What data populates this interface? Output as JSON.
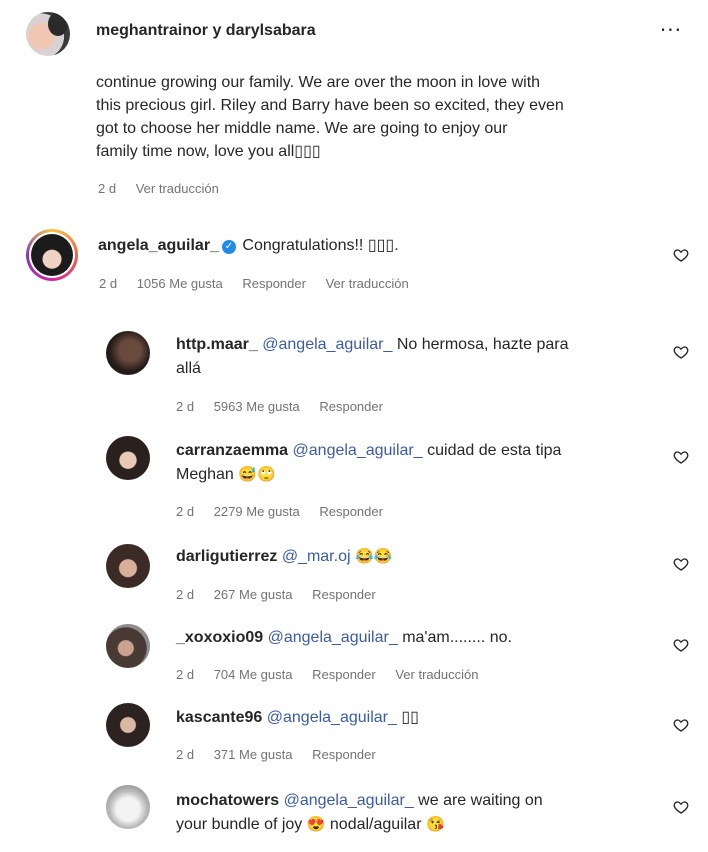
{
  "post": {
    "owner_names": "meghantrainor y darylsabara",
    "more_icon": "more-horizontal-icon",
    "caption_lines": [
      "continue growing our family. We are over the moon in love with",
      "this precious girl. Riley and Barry have been so excited, they even",
      "got to choose her middle name. We are going to enjoy our",
      "family time now, love you all▯▯▯"
    ],
    "caption_age": "2 d",
    "caption_translate": "Ver traducción"
  },
  "comments": [
    {
      "username": "angela_aguilar_",
      "verified": true,
      "text": "Congratulations!! ▯▯▯.",
      "age": "2 d",
      "likes": "1056 Me gusta",
      "reply": "Responder",
      "translate": "Ver traducción"
    }
  ],
  "replies": [
    {
      "username": "http.maar_",
      "mention": "@angela_aguilar_",
      "text_line1": "No hermosa, hazte para",
      "text_line2": "allá",
      "age": "2 d",
      "likes": "5963 Me gusta",
      "reply": "Responder"
    },
    {
      "username": "carranzaemma",
      "mention": "@angela_aguilar_",
      "text_line1": "cuidad de esta tipa",
      "text_line2": "Meghan",
      "emojis": "😅🙄",
      "age": "2 d",
      "likes": "2279 Me gusta",
      "reply": "Responder"
    },
    {
      "username": "darligutierrez",
      "mention": "@_mar.oj",
      "emojis": "😂😂",
      "age": "2 d",
      "likes": "267 Me gusta",
      "reply": "Responder"
    },
    {
      "username": "_xoxoxio09",
      "mention": "@angela_aguilar_",
      "text_line1": "ma'am........ no.",
      "age": "2 d",
      "likes": "704 Me gusta",
      "reply": "Responder",
      "translate": "Ver traducción"
    },
    {
      "username": "kascante96",
      "mention": "@angela_aguilar_",
      "text_line1": "▯▯",
      "age": "2 d",
      "likes": "371 Me gusta",
      "reply": "Responder"
    },
    {
      "username": "mochatowers",
      "mention": "@angela_aguilar_",
      "text_line1": "we are waiting on",
      "text_line2a": "your bundle of joy",
      "emoji_a": "😍",
      "text_line2b": "nodal/aguilar",
      "emoji_b": "😘"
    }
  ],
  "icons": {
    "like": "heart-outline-icon",
    "verified": "verified-badge-icon"
  },
  "colors": {
    "mention": "#3b5ba8",
    "meta": "#737373",
    "verified": "#1f8cec"
  }
}
